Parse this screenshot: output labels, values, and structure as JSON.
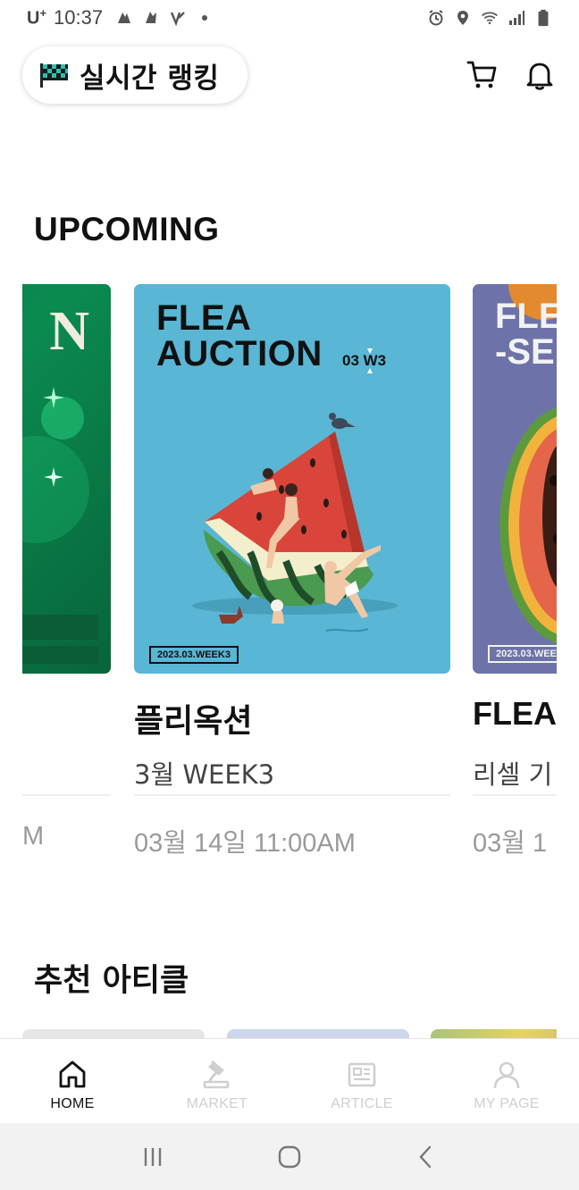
{
  "status_bar": {
    "carrier": "U",
    "carrier_sup": "+",
    "time": "10:37"
  },
  "header": {
    "ranking_label": "실시간 랭킹"
  },
  "upcoming": {
    "title": "UPCOMING",
    "cards": [
      {
        "poster_text": "N",
        "title": "",
        "subtitle": "",
        "date": "M"
      },
      {
        "poster_title_line1": "FLEA",
        "poster_title_line2": "AUCTION",
        "poster_week": "03 W3",
        "poster_date": "2023.03.WEEK3",
        "title": "플리옥션",
        "subtitle": "3월 WEEK3",
        "date": "03월 14일 11:00AM"
      },
      {
        "poster_title_line1": "FLE",
        "poster_title_line2": "-SE",
        "poster_date": "2023.03.WEE",
        "title": "FLEA",
        "subtitle": "리셀 기",
        "date": "03월 1"
      }
    ]
  },
  "articles": {
    "title": "추천 아티클"
  },
  "bottom_nav": {
    "items": [
      {
        "label": "HOME",
        "icon": "home-icon",
        "active": true
      },
      {
        "label": "MARKET",
        "icon": "gavel-icon",
        "active": false
      },
      {
        "label": "ARTICLE",
        "icon": "newspaper-icon",
        "active": false
      },
      {
        "label": "MY PAGE",
        "icon": "person-icon",
        "active": false
      }
    ]
  },
  "colors": {
    "center_poster_bg": "#59b6d4",
    "left_poster_bg": "#0b8a50",
    "right_poster_bg": "#6d73a8",
    "nav_active": "#111111",
    "nav_inactive": "#cfcfcf"
  }
}
